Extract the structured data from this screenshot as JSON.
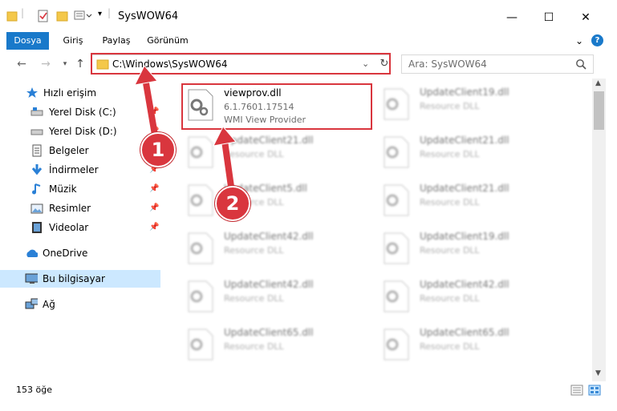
{
  "window": {
    "title": "SysWOW64",
    "minimize_glyph": "—",
    "maximize_glyph": "☐",
    "close_glyph": "✕"
  },
  "ribbon": {
    "tabs": [
      "Dosya",
      "Giriş",
      "Paylaş",
      "Görünüm"
    ],
    "help_glyph": "?",
    "collapse_glyph": "⌄"
  },
  "address": {
    "path": "C:\\Windows\\SysWOW64",
    "search_placeholder": "Ara: SysWOW64"
  },
  "sidebar": {
    "items": [
      {
        "label": "Hızlı erişim",
        "icon": "star-icon"
      },
      {
        "label": "Yerel Disk (C:)",
        "icon": "drive-icon",
        "pinned": true
      },
      {
        "label": "Yerel Disk (D:)",
        "icon": "drive-icon",
        "pinned": true
      },
      {
        "label": "Belgeler",
        "icon": "document-icon",
        "pinned": true
      },
      {
        "label": "İndirmeler",
        "icon": "download-icon",
        "pinned": true
      },
      {
        "label": "Müzik",
        "icon": "music-icon",
        "pinned": true
      },
      {
        "label": "Resimler",
        "icon": "pictures-icon",
        "pinned": true
      },
      {
        "label": "Videolar",
        "icon": "video-icon",
        "pinned": true
      },
      {
        "label": "OneDrive",
        "icon": "cloud-icon"
      },
      {
        "label": "Bu bilgisayar",
        "icon": "computer-icon",
        "selected": true
      },
      {
        "label": "Ağ",
        "icon": "network-icon"
      }
    ]
  },
  "files": {
    "highlighted": {
      "name": "viewprov.dll",
      "version": "6.1.7601.17514",
      "description": "WMI View Provider"
    },
    "col2_top": {
      "name": "UpdateClient19.dll",
      "type": "Resource DLL"
    },
    "rows": [
      {
        "left": "UpdateClient21.dll",
        "right": "UpdateClient21.dll",
        "type": "Resource DLL"
      },
      {
        "left": "UpdateClient5.dll",
        "right": "UpdateClient21.dll",
        "type": "Resource DLL"
      },
      {
        "left": "UpdateClient42.dll",
        "right": "UpdateClient19.dll",
        "type": "Resource DLL"
      },
      {
        "left": "UpdateClient42.dll",
        "right": "UpdateClient42.dll",
        "type": "Resource DLL"
      },
      {
        "left": "UpdateClient65.dll",
        "right": "UpdateClient65.dll",
        "type": "Resource DLL"
      }
    ]
  },
  "status": {
    "count": "153 öğe"
  },
  "callouts": [
    "1",
    "2"
  ],
  "colors": {
    "accent": "#1979ca",
    "highlight": "#d9363e",
    "selection": "#cce8ff"
  }
}
